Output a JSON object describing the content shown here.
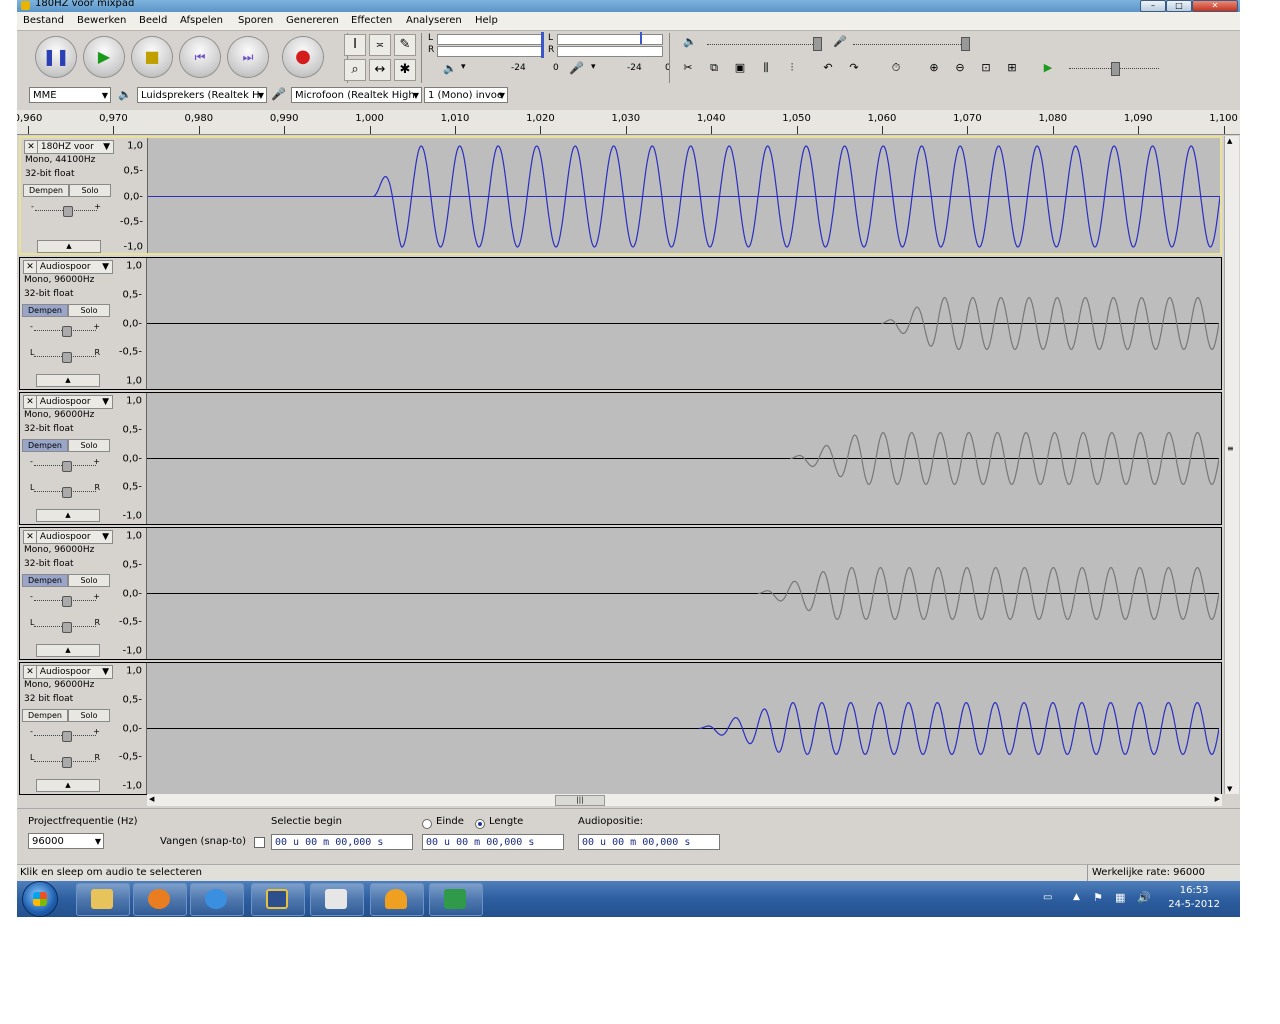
{
  "window": {
    "title": "180HZ voor mixpad"
  },
  "menu": [
    "Bestand",
    "Bewerken",
    "Beeld",
    "Afspelen",
    "Sporen",
    "Genereren",
    "Effecten",
    "Analyseren",
    "Help"
  ],
  "meters": {
    "channel_l": "L",
    "channel_r": "R",
    "play_scale_mid": "-24",
    "play_scale_end": "0",
    "rec_scale_mid": "-24",
    "rec_scale_end": "0"
  },
  "device": {
    "host": "MME",
    "output": "Luidsprekers (Realtek H",
    "input": "Microfoon (Realtek High",
    "channels": "1 (Mono) invoe"
  },
  "ruler": {
    "ticks": [
      "0,960",
      "0,970",
      "0,980",
      "0,990",
      "1,000",
      "1,010",
      "1,020",
      "1,030",
      "1,040",
      "1,050",
      "1,060",
      "1,070",
      "1,080",
      "1,090",
      "1,100"
    ]
  },
  "track_buttons": {
    "mute": "Dempen",
    "solo": "Solo"
  },
  "pan": {
    "left": "L",
    "right": "R"
  },
  "gain": {
    "minus": "-",
    "plus": "+"
  },
  "tracks": [
    {
      "name": "180HZ voor",
      "format": "Mono, 44100Hz",
      "bits": "32-bit float",
      "scale": [
        "1,0",
        "0,5-",
        "0,0-",
        "-0,5-",
        "-1,0"
      ],
      "wave_color": "#2a2fc0",
      "start_fraction": 0.21,
      "cycles": 22,
      "amplitude": 1.0,
      "mute_on": false
    },
    {
      "name": "Audiospoor",
      "format": "Mono, 96000Hz",
      "bits": "32-bit float",
      "scale": [
        "1,0",
        "0,5-",
        "0,0-",
        "-0,5-",
        "1,0"
      ],
      "wave_color": "#777777",
      "start_fraction": 0.685,
      "cycles": 12,
      "amplitude": 0.45,
      "mute_on": true
    },
    {
      "name": "Audiospoor",
      "format": "Mono, 96000Hz",
      "bits": "32-bit float",
      "scale": [
        "1,0",
        "0,5-",
        "0,0-",
        "0,5-",
        "-1,0"
      ],
      "wave_color": "#777777",
      "start_fraction": 0.6,
      "cycles": 15,
      "amplitude": 0.45,
      "mute_on": true
    },
    {
      "name": "Audiospoor",
      "format": "Mono, 96000Hz",
      "bits": "32-bit float",
      "scale": [
        "1,0",
        "0,5-",
        "0,0-",
        "-0,5-",
        "-1,0"
      ],
      "wave_color": "#777777",
      "start_fraction": 0.57,
      "cycles": 16,
      "amplitude": 0.45,
      "mute_on": true
    },
    {
      "name": "Audiospoor",
      "format": "Mono, 96000Hz",
      "bits": "32 bit float",
      "scale": [
        "1,0",
        "0,5-",
        "0,0-",
        "-0,5-",
        "-1,0"
      ],
      "wave_color": "#2a2fc0",
      "start_fraction": 0.515,
      "cycles": 18,
      "amplitude": 0.45,
      "mute_on": false
    }
  ],
  "selection": {
    "rate_label": "Projectfrequentie (Hz)",
    "rate_value": "96000",
    "snap_label": "Vangen (snap-to)",
    "sel_begin_label": "Selectie begin",
    "end_label": "Einde",
    "length_label": "Lengte",
    "audio_pos_label": "Audiopositie:",
    "time_begin": "00 u 00 m 00,000 s",
    "time_length": "00 u 00 m 00,000 s",
    "time_pos": "00 u 00 m 00,000 s"
  },
  "status": {
    "hint": "Klik en sleep om audio te selecteren",
    "rate": "Werkelijke rate: 96000"
  },
  "clock": {
    "time": "16:53",
    "date": "24-5-2012"
  },
  "colors": {
    "waveform_blue": "#2a2fc0",
    "waveform_grey": "#777777",
    "track_bg": "#bdbdbd",
    "taskbar": "#2d5e9f"
  }
}
